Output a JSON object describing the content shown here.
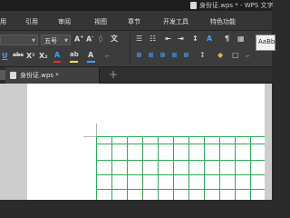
{
  "window": {
    "title": "身份证.wps * - WPS 文字"
  },
  "menu": [
    {
      "label": "用"
    },
    {
      "label": "引用"
    },
    {
      "label": "审阅"
    },
    {
      "label": "视图"
    },
    {
      "label": "章节"
    },
    {
      "label": "开发工具"
    },
    {
      "label": "特色功能"
    }
  ],
  "ribbon": {
    "font_name": "",
    "font_size": "五号",
    "style_preview": "AaBb",
    "buttons": [
      {
        "name": "grow-font-button",
        "glyph": "A",
        "sup": "+"
      },
      {
        "name": "shrink-font-button",
        "glyph": "A",
        "sup": "-"
      },
      {
        "name": "clear-format-button",
        "glyph": "◊"
      },
      {
        "name": "phonetic-button",
        "glyph": "文"
      },
      {
        "name": "bullets-button",
        "glyph": "☰"
      },
      {
        "name": "numbering-button",
        "glyph": "☷"
      },
      {
        "name": "decrease-indent-button",
        "glyph": "⇤"
      },
      {
        "name": "increase-indent-button",
        "glyph": "⇥"
      },
      {
        "name": "line-spacing-button",
        "glyph": "↕"
      },
      {
        "name": "show-marks-button",
        "glyph": "¶"
      },
      {
        "name": "table-button",
        "glyph": "▦"
      },
      {
        "name": "underline-button",
        "glyph": "U"
      },
      {
        "name": "strikethrough-button",
        "glyph": "abc"
      },
      {
        "name": "superscript-button",
        "glyph": "X²"
      },
      {
        "name": "subscript-button",
        "glyph": "X₂"
      },
      {
        "name": "font-color-button",
        "glyph": "A"
      },
      {
        "name": "highlight-button",
        "glyph": "ab"
      },
      {
        "name": "shading-button",
        "glyph": "A"
      },
      {
        "name": "align-left-button",
        "glyph": "≡"
      },
      {
        "name": "align-center-button",
        "glyph": "≡"
      },
      {
        "name": "align-right-button",
        "glyph": "≡"
      },
      {
        "name": "justify-button",
        "glyph": "≡"
      },
      {
        "name": "distribute-button",
        "glyph": "≡"
      },
      {
        "name": "fill-color-button",
        "glyph": "◆"
      },
      {
        "name": "borders-button",
        "glyph": "▢"
      }
    ],
    "group_launcher_glyph": "⌐"
  },
  "tabs": {
    "document": "身份证.wps *",
    "new_tab": "+"
  },
  "colors": {
    "accent": "#3da0ff",
    "grid_line": "#2faa5a",
    "font_color_bar": "#e23030",
    "highlight_bar": "#ffe14a"
  }
}
